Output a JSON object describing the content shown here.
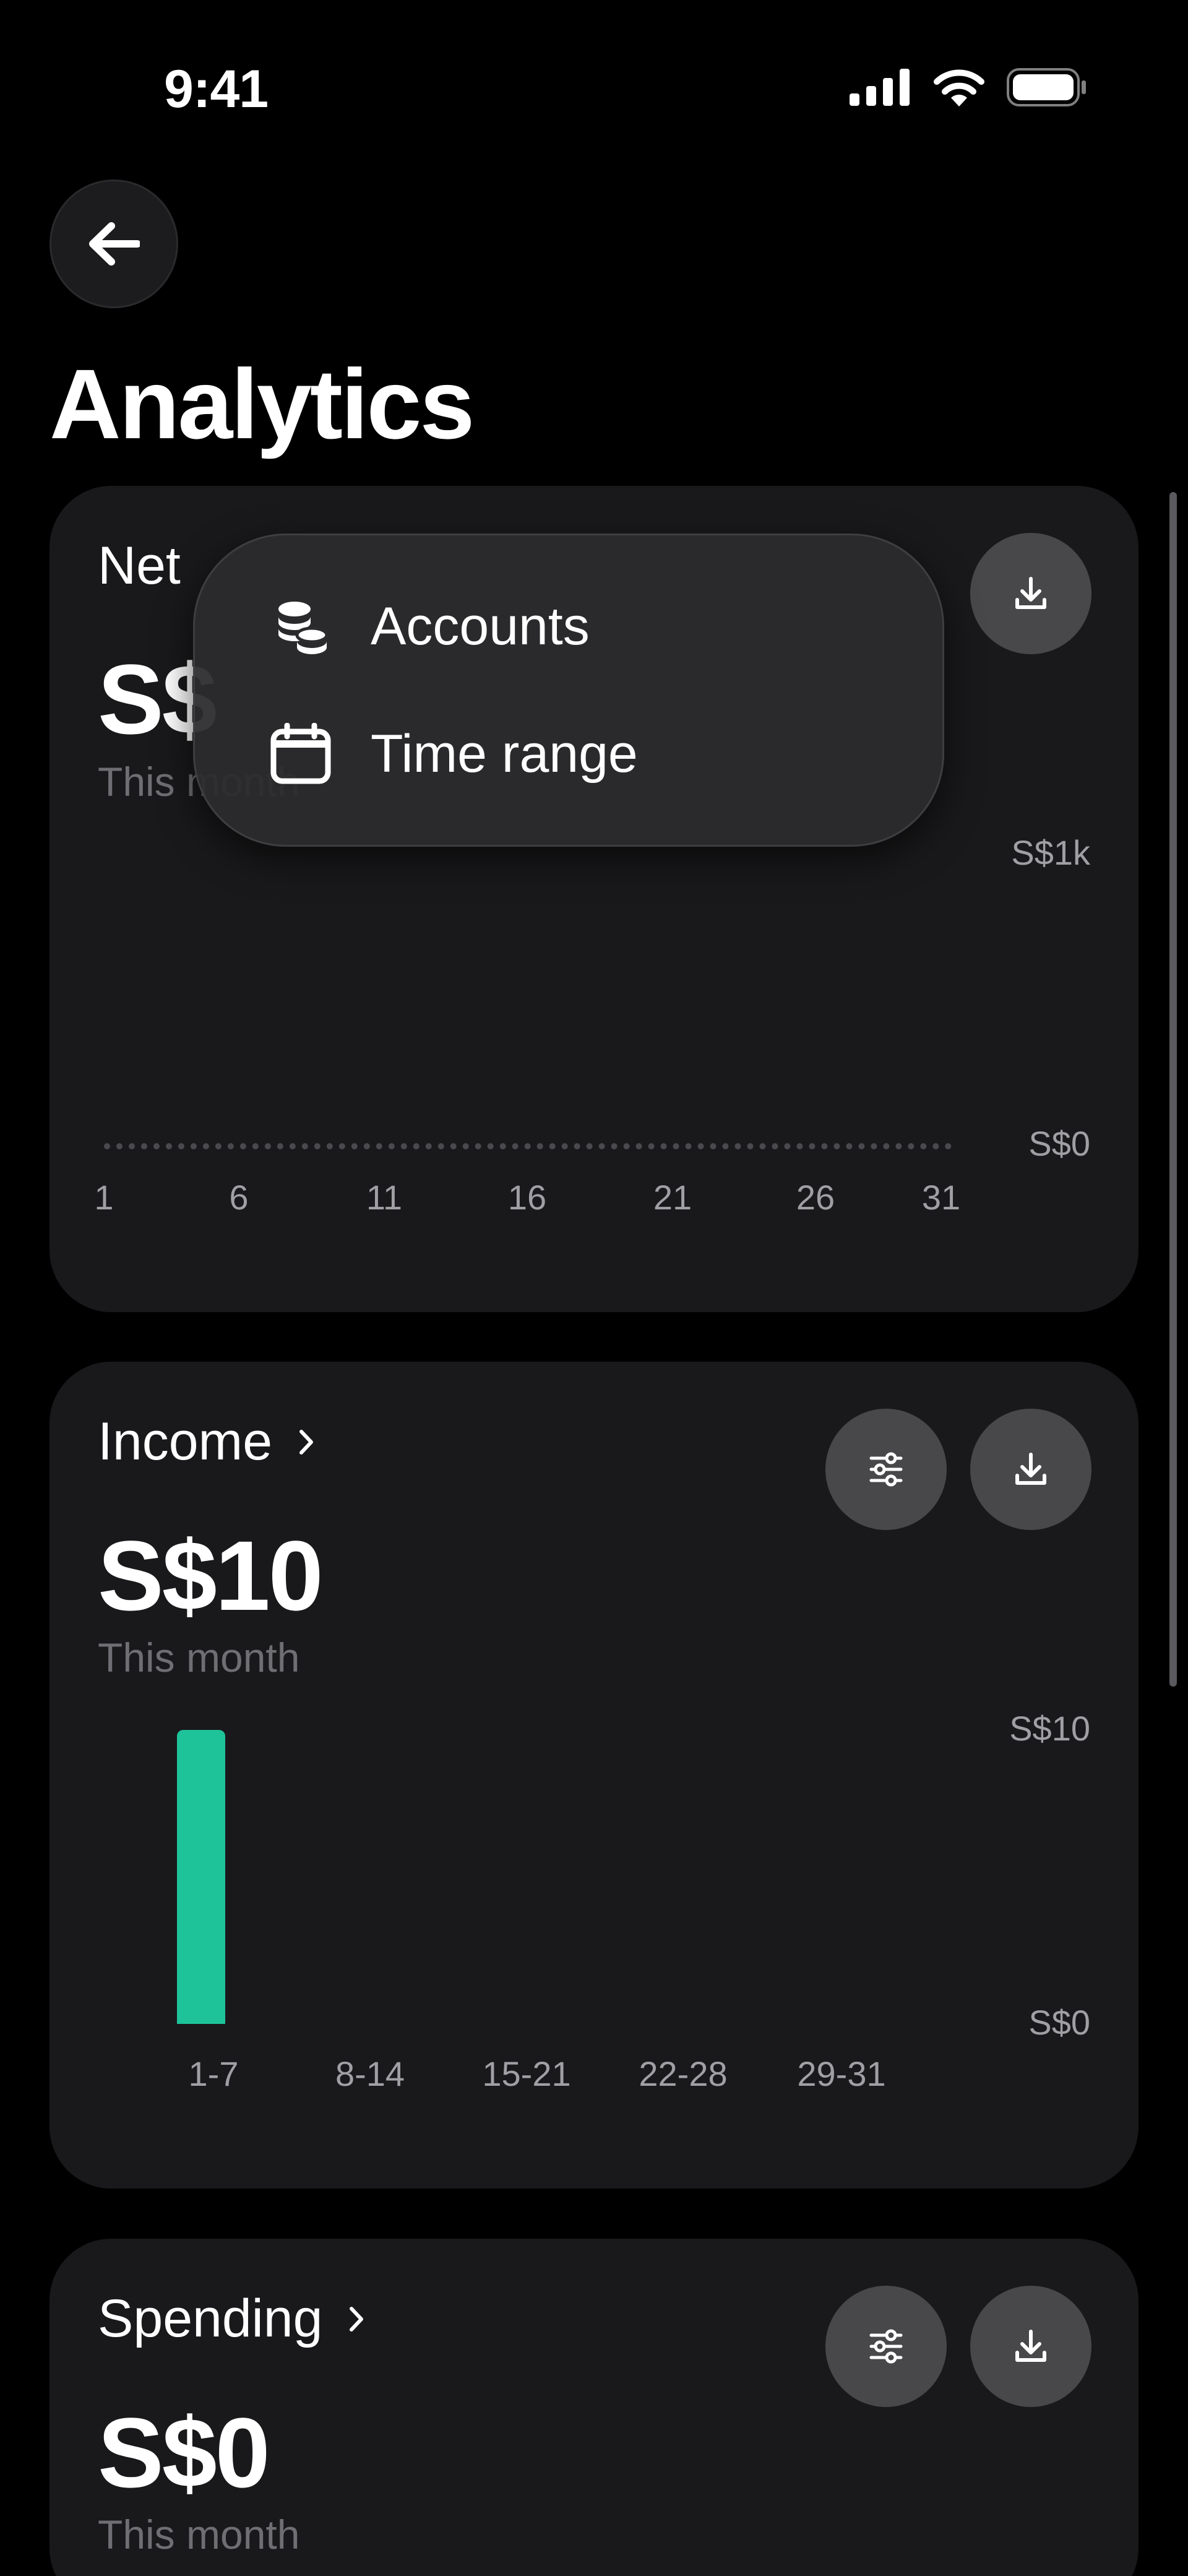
{
  "status_bar": {
    "time": "9:41"
  },
  "header": {
    "title": "Analytics"
  },
  "net_card": {
    "title": "Net",
    "amount": "S$",
    "subtitle": "This month",
    "y_labels": [
      "S$1k",
      "S$0"
    ],
    "x_labels": [
      "1",
      "6",
      "11",
      "16",
      "21",
      "26",
      "31"
    ]
  },
  "popup_menu": {
    "items": [
      {
        "label": "Accounts",
        "icon": "coins-icon"
      },
      {
        "label": "Time range",
        "icon": "calendar-icon"
      }
    ]
  },
  "income_card": {
    "title": "Income",
    "amount": "S$10",
    "subtitle": "This month",
    "y_labels": [
      "S$10",
      "S$0"
    ],
    "x_labels": [
      "1-7",
      "8-14",
      "15-21",
      "22-28",
      "29-31"
    ],
    "values": [
      10,
      0,
      0,
      0,
      0
    ],
    "bar_color": "#1ec39a"
  },
  "spending_card": {
    "title": "Spending",
    "amount": "S$0",
    "subtitle": "This month"
  }
}
